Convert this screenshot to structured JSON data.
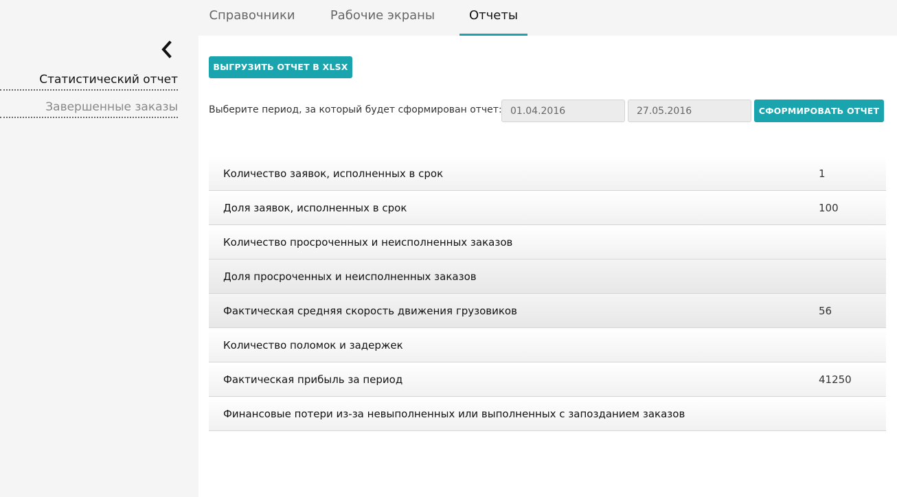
{
  "tabs": [
    {
      "label": "Справочники"
    },
    {
      "label": "Рабочие экраны"
    },
    {
      "label": "Отчеты",
      "active": true
    }
  ],
  "sidebar": {
    "collapse_icon": "chevron-left-icon",
    "items": [
      {
        "label": "Статистический отчет",
        "active": true
      },
      {
        "label": "Завершенные заказы"
      }
    ]
  },
  "toolbar": {
    "export_label": "ВЫГРУЗИТЬ ОТЧЕТ В XLSX"
  },
  "period": {
    "label": "Выберите период, за который будет сформирован отчет:",
    "from": "01.04.2016",
    "to": "27.05.2016",
    "generate_label": "СФОРМИРОВАТЬ ОТЧЕТ"
  },
  "report": {
    "rows": [
      {
        "label": "Количество заявок, исполненных в срок",
        "value": "1"
      },
      {
        "label": "Доля заявок, исполненных в срок",
        "value": "100"
      },
      {
        "label": "Количество просроченных и неисполненных заказов",
        "value": ""
      },
      {
        "label": "Доля просроченных и неисполненных заказов",
        "value": ""
      },
      {
        "label": "Фактическая средняя скорость движения грузовиков",
        "value": "56"
      },
      {
        "label": "Количество поломок и задержек",
        "value": ""
      },
      {
        "label": "Фактическая прибыль за период",
        "value": "41250"
      },
      {
        "label": "Финансовые потери из-за невыполненных или выполненных с запозданием заказов",
        "value": ""
      }
    ]
  },
  "colors": {
    "accent": "#19a4ae",
    "tab_underline": "#1aa3ad"
  }
}
